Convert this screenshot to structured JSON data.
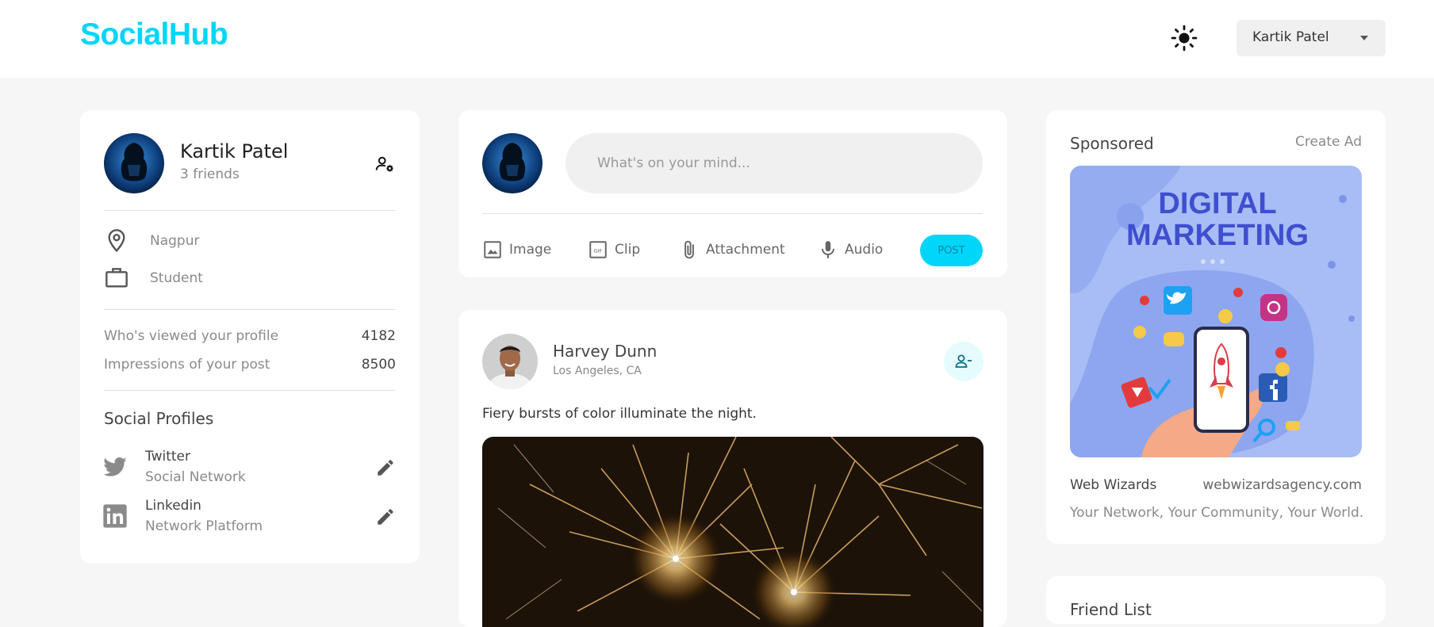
{
  "header": {
    "logo": "SocialHub",
    "user_name": "Kartik Patel"
  },
  "profile": {
    "name": "Kartik Patel",
    "friends": "3 friends",
    "location": "Nagpur",
    "occupation": "Student",
    "stats": [
      {
        "label": "Who's viewed your profile",
        "value": "4182"
      },
      {
        "label": "Impressions of your post",
        "value": "8500"
      }
    ],
    "social_title": "Social Profiles",
    "social": [
      {
        "name": "Twitter",
        "type": "Social Network"
      },
      {
        "name": "Linkedin",
        "type": "Network Platform"
      }
    ]
  },
  "composer": {
    "placeholder": "What's on your mind...",
    "actions": [
      "Image",
      "Clip",
      "Attachment",
      "Audio"
    ],
    "post_label": "POST"
  },
  "feed": {
    "author": "Harvey Dunn",
    "location": "Los Angeles, CA",
    "text": "Fiery bursts of color illuminate the night."
  },
  "sponsored": {
    "title": "Sponsored",
    "create_label": "Create Ad",
    "ad_headline_1": "DIGITAL",
    "ad_headline_2": "MARKETING",
    "company": "Web Wizards",
    "url": "webwizardsagency.com",
    "tagline": "Your Network, Your Community, Your World."
  },
  "friend_list": {
    "title": "Friend List"
  },
  "colors": {
    "accent": "#00d5fa",
    "background": "#f6f6f6",
    "card": "#ffffff"
  }
}
